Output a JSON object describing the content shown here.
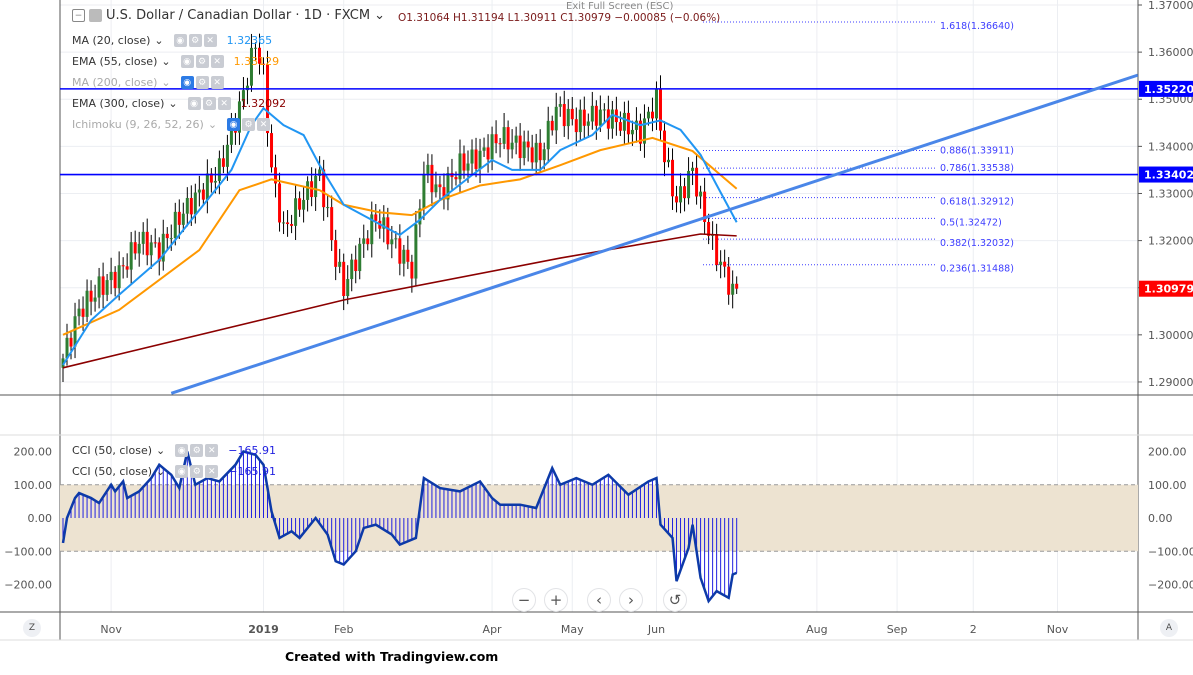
{
  "header": {
    "title": "U.S. Dollar / Canadian Dollar · 1D · FXCM",
    "exit_fullscreen": "Exit Full Screen (ESC)",
    "ohlc": "O1.31064  H1.31194  L1.30911  C1.30979  −0.00085 (−0.06%)"
  },
  "indicators": [
    {
      "label": "MA (20, close)",
      "value": "1.32365",
      "color": "#2196f3",
      "hidden": false
    },
    {
      "label": "EMA (55, close)",
      "value": "1.33129",
      "color": "#ff9800",
      "hidden": false
    },
    {
      "label": "MA (200, close)",
      "value": "",
      "color": "#aaaaaa",
      "hidden": true
    },
    {
      "label": "EMA (300, close)",
      "value": "1.32092",
      "color": "#8b0000",
      "hidden": false
    },
    {
      "label": "Ichimoku (9, 26, 52, 26)",
      "value": "",
      "color": "#aaaaaa",
      "hidden": true
    }
  ],
  "cci_legend": [
    {
      "label": "CCI (50, close)",
      "value": "−165.91"
    },
    {
      "label": "CCI (50, close)",
      "value": "−165.91"
    }
  ],
  "toolbar": {
    "zoom_out": "−",
    "zoom_in": "+",
    "back": "‹",
    "forward": "›",
    "reset": "↺"
  },
  "axis_buttons": {
    "left": "Z",
    "right": "A"
  },
  "credit": "Created with Tradingview.com",
  "colors": {
    "up": "#2e7d32",
    "down": "#ff0000",
    "hline": "#0000ff",
    "trend": "#4a86e8",
    "cci": "#0d3aa8"
  },
  "chart_data": [
    {
      "type": "candlestick",
      "title": "USD/CAD 1D",
      "ylim": [
        1.2875,
        1.37
      ],
      "price_ticks": [
        "1.37000",
        "1.36000",
        "1.35000",
        "1.34000",
        "1.33000",
        "1.32000",
        "1.31000",
        "1.30000",
        "1.29000"
      ],
      "time_ticks": [
        {
          "label": "Nov",
          "bar": 12
        },
        {
          "label": "2019",
          "bar": 50
        },
        {
          "label": "Feb",
          "bar": 70
        },
        {
          "label": "Apr",
          "bar": 107
        },
        {
          "label": "May",
          "bar": 127
        },
        {
          "label": "Jun",
          "bar": 148
        },
        {
          "label": "Aug",
          "bar": 188
        },
        {
          "label": "Sep",
          "bar": 208
        },
        {
          "label": "2",
          "bar": 227
        },
        {
          "label": "Nov",
          "bar": 248
        }
      ],
      "close_anchors": [
        [
          0,
          1.295
        ],
        [
          4,
          1.305
        ],
        [
          9,
          1.31
        ],
        [
          14,
          1.313
        ],
        [
          19,
          1.32
        ],
        [
          24,
          1.318
        ],
        [
          29,
          1.325
        ],
        [
          34,
          1.33
        ],
        [
          39,
          1.335
        ],
        [
          44,
          1.348
        ],
        [
          48,
          1.362
        ],
        [
          50,
          1.355
        ],
        [
          52,
          1.335
        ],
        [
          55,
          1.322
        ],
        [
          59,
          1.328
        ],
        [
          64,
          1.334
        ],
        [
          68,
          1.316
        ],
        [
          70,
          1.31
        ],
        [
          74,
          1.318
        ],
        [
          78,
          1.325
        ],
        [
          82,
          1.32
        ],
        [
          87,
          1.314
        ],
        [
          90,
          1.335
        ],
        [
          94,
          1.33
        ],
        [
          99,
          1.336
        ],
        [
          104,
          1.338
        ],
        [
          109,
          1.342
        ],
        [
          114,
          1.34
        ],
        [
          119,
          1.338
        ],
        [
          123,
          1.348
        ],
        [
          128,
          1.345
        ],
        [
          134,
          1.347
        ],
        [
          139,
          1.345
        ],
        [
          144,
          1.343
        ],
        [
          148,
          1.35
        ],
        [
          150,
          1.338
        ],
        [
          153,
          1.328
        ],
        [
          157,
          1.335
        ],
        [
          159,
          1.328
        ],
        [
          162,
          1.319
        ],
        [
          164,
          1.315
        ],
        [
          167,
          1.309
        ],
        [
          168,
          1.30979
        ]
      ],
      "ma20": [
        [
          0,
          1.2936
        ],
        [
          7,
          1.3031
        ],
        [
          14,
          1.3085
        ],
        [
          24,
          1.3159
        ],
        [
          34,
          1.3265
        ],
        [
          42,
          1.335
        ],
        [
          47,
          1.3445
        ],
        [
          50,
          1.3481
        ],
        [
          55,
          1.3445
        ],
        [
          60,
          1.3424
        ],
        [
          64,
          1.336
        ],
        [
          70,
          1.3276
        ],
        [
          77,
          1.3244
        ],
        [
          84,
          1.3212
        ],
        [
          89,
          1.3244
        ],
        [
          94,
          1.3286
        ],
        [
          102,
          1.3339
        ],
        [
          107,
          1.3371
        ],
        [
          112,
          1.335
        ],
        [
          119,
          1.335
        ],
        [
          124,
          1.3392
        ],
        [
          132,
          1.3424
        ],
        [
          137,
          1.3467
        ],
        [
          144,
          1.3445
        ],
        [
          149,
          1.3455
        ],
        [
          154,
          1.3435
        ],
        [
          159,
          1.3382
        ],
        [
          163,
          1.3318
        ],
        [
          168,
          1.3239
        ]
      ],
      "ema55": [
        [
          0,
          1.3
        ],
        [
          14,
          1.3053
        ],
        [
          34,
          1.318
        ],
        [
          44,
          1.3307
        ],
        [
          52,
          1.333
        ],
        [
          64,
          1.3307
        ],
        [
          70,
          1.3276
        ],
        [
          79,
          1.326
        ],
        [
          87,
          1.3254
        ],
        [
          94,
          1.3286
        ],
        [
          104,
          1.3317
        ],
        [
          114,
          1.333
        ],
        [
          124,
          1.336
        ],
        [
          134,
          1.3392
        ],
        [
          147,
          1.3418
        ],
        [
          157,
          1.339
        ],
        [
          168,
          1.331
        ]
      ],
      "ema300": [
        [
          0,
          1.293
        ],
        [
          70,
          1.3074
        ],
        [
          124,
          1.3163
        ],
        [
          159,
          1.3214
        ],
        [
          168,
          1.321
        ]
      ],
      "hlines": [
        {
          "price": 1.3522,
          "label": "1.35220"
        },
        {
          "price": 1.33402,
          "label": "1.33402"
        }
      ],
      "last_price": {
        "price": 1.30979,
        "label": "1.30979"
      },
      "trendline": [
        [
          27,
          1.2876
        ],
        [
          268,
          1.3551
        ]
      ],
      "fib": [
        {
          "price": 1.3664,
          "label": "1.618(1.36640)"
        },
        {
          "price": 1.33911,
          "label": "0.886(1.33911)"
        },
        {
          "price": 1.33538,
          "label": "0.786(1.33538)"
        },
        {
          "price": 1.32912,
          "label": "0.618(1.32912)"
        },
        {
          "price": 1.32472,
          "label": "0.5(1.32472)"
        },
        {
          "price": 1.32032,
          "label": "0.382(1.32032)"
        },
        {
          "price": 1.31488,
          "label": "0.236(1.31488)"
        }
      ]
    },
    {
      "type": "line",
      "title": "CCI (50, close)",
      "ylim": [
        -280,
        230
      ],
      "ticks": [
        "200.00",
        "100.00",
        "0.00",
        "−100.00",
        "−200.00"
      ],
      "band": [
        -100,
        100
      ],
      "anchors": [
        [
          0,
          -75
        ],
        [
          1,
          0
        ],
        [
          3,
          60
        ],
        [
          4,
          75
        ],
        [
          7,
          60
        ],
        [
          9,
          45
        ],
        [
          12,
          100
        ],
        [
          13,
          80
        ],
        [
          15,
          110
        ],
        [
          16,
          60
        ],
        [
          19,
          80
        ],
        [
          22,
          120
        ],
        [
          24,
          160
        ],
        [
          27,
          130
        ],
        [
          29,
          90
        ],
        [
          31,
          200
        ],
        [
          33,
          100
        ],
        [
          36,
          120
        ],
        [
          39,
          110
        ],
        [
          43,
          160
        ],
        [
          45,
          200
        ],
        [
          48,
          190
        ],
        [
          50,
          160
        ],
        [
          52,
          20
        ],
        [
          54,
          -60
        ],
        [
          57,
          -40
        ],
        [
          59,
          -60
        ],
        [
          63,
          0
        ],
        [
          66,
          -50
        ],
        [
          68,
          -130
        ],
        [
          70,
          -140
        ],
        [
          73,
          -100
        ],
        [
          75,
          -30
        ],
        [
          78,
          -20
        ],
        [
          82,
          -50
        ],
        [
          84,
          -80
        ],
        [
          88,
          -60
        ],
        [
          90,
          120
        ],
        [
          94,
          90
        ],
        [
          99,
          80
        ],
        [
          104,
          110
        ],
        [
          107,
          60
        ],
        [
          109,
          40
        ],
        [
          114,
          40
        ],
        [
          118,
          30
        ],
        [
          122,
          150
        ],
        [
          124,
          100
        ],
        [
          128,
          120
        ],
        [
          132,
          100
        ],
        [
          136,
          130
        ],
        [
          141,
          70
        ],
        [
          146,
          110
        ],
        [
          148,
          120
        ],
        [
          149,
          -20
        ],
        [
          152,
          -60
        ],
        [
          153,
          -190
        ],
        [
          156,
          -90
        ],
        [
          157,
          -20
        ],
        [
          159,
          -180
        ],
        [
          161,
          -250
        ],
        [
          163,
          -220
        ],
        [
          166,
          -240
        ],
        [
          167,
          -170
        ],
        [
          168,
          -165
        ]
      ]
    }
  ]
}
